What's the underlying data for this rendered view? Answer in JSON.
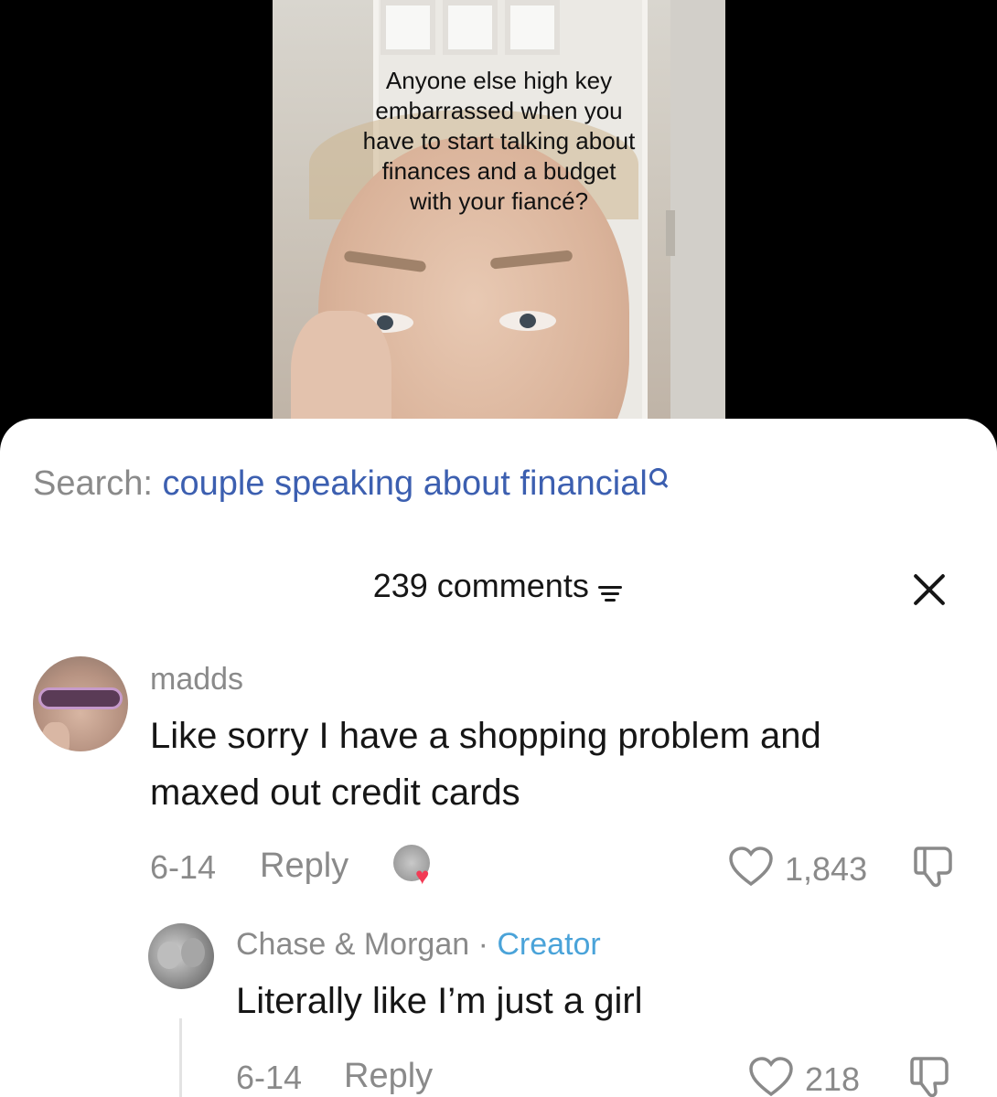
{
  "video": {
    "caption_lines": [
      "Anyone else high key",
      "embarrassed when you",
      "have to start talking about",
      "finances and a budget",
      "with your fiancé?"
    ]
  },
  "search": {
    "label": "Search:",
    "term": "couple speaking about financial",
    "icon": "search-icon",
    "term_color": "#3c5fb0"
  },
  "comments_header": {
    "count_label": "239 comments",
    "filter_icon": "filter-icon",
    "close_icon": "close-icon"
  },
  "comments": [
    {
      "username": "madds",
      "text_lines": [
        "Like sorry I have a shopping problem and",
        "maxed out credit cards"
      ],
      "date": "6-14",
      "reply_label": "Reply",
      "likes": "1,843",
      "creator_liked": true
    }
  ],
  "replies": [
    {
      "username": "Chase & Morgan",
      "separator": "·",
      "badge": "Creator",
      "badge_color": "#4aa3d9",
      "text": "Literally like I’m just a girl",
      "date": "6-14",
      "reply_label": "Reply",
      "likes": "218"
    }
  ],
  "colors": {
    "muted_text": "#8a8a8a",
    "primary_text": "#161616",
    "heart_badge": "#f23b55"
  }
}
